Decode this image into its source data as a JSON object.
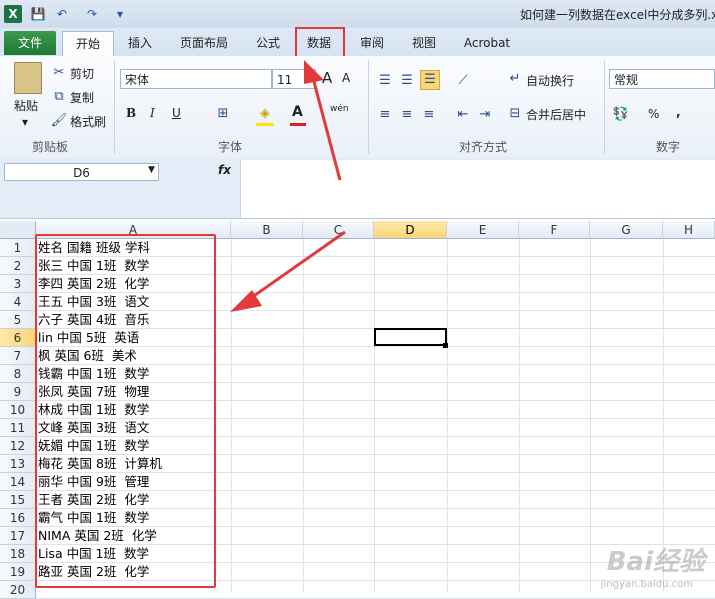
{
  "window": {
    "title": "如何建一列数据在excel中分成多列.x",
    "app_logo": "X"
  },
  "quick_access": {
    "save_icon": "save-icon",
    "undo_icon": "undo-icon",
    "redo_icon": "redo-icon"
  },
  "tabs": [
    {
      "label": "文件"
    },
    {
      "label": "开始"
    },
    {
      "label": "插入"
    },
    {
      "label": "页面布局"
    },
    {
      "label": "公式"
    },
    {
      "label": "数据"
    },
    {
      "label": "审阅"
    },
    {
      "label": "视图"
    },
    {
      "label": "Acrobat"
    }
  ],
  "clipboard": {
    "paste": "粘贴",
    "cut": "剪切",
    "copy": "复制",
    "format_painter": "格式刷",
    "group": "剪贴板"
  },
  "font": {
    "name": "宋体",
    "size": "11",
    "bold": "B",
    "italic": "I",
    "underline": "U",
    "group": "字体",
    "grow": "A",
    "shrink": "A",
    "wen": "wén"
  },
  "alignment": {
    "wrap": "自动换行",
    "merge": "合并后居中",
    "group": "对齐方式"
  },
  "number": {
    "format": "常规",
    "percent": "%",
    "comma": ",",
    "group": "数字"
  },
  "name_box": "D6",
  "fx": "fx",
  "columns": [
    "A",
    "B",
    "C",
    "D",
    "E",
    "F",
    "G",
    "H"
  ],
  "selected_column": "D",
  "selected_row": 6,
  "rows": [
    "1",
    "2",
    "3",
    "4",
    "5",
    "6",
    "7",
    "8",
    "9",
    "10",
    "11",
    "12",
    "13",
    "14",
    "15",
    "16",
    "17",
    "18",
    "19",
    "20"
  ],
  "cells_a": [
    "姓名 国籍 班级 学科",
    "张三 中国 1班  数学",
    "李四 英国 2班  化学",
    "王五 中国 3班  语文",
    "六子 英国 4班  音乐",
    "lin 中国 5班  英语",
    "枫 英国 6班  美术",
    "钱霸 中国 1班  数学",
    "张凤 英国 7班  物理",
    "林成 中国 1班  数学",
    "文峰 英国 3班  语文",
    "妩媚 中国 1班  数学",
    "梅花 英国 8班  计算机",
    "丽华 中国 9班  管理",
    "王者 英国 2班  化学",
    "霸气 中国 1班  数学",
    "NIMA 英国 2班  化学",
    "Lisa 中国 1班  数学",
    "路亚 英国 2班  化学"
  ],
  "watermark": "Bai经验",
  "watermark_sub": "jingyan.baidu.com",
  "colors": {
    "highlight": "#e23a3a",
    "file_tab": "#1e7a33",
    "selected_header": "#f9d57a"
  }
}
